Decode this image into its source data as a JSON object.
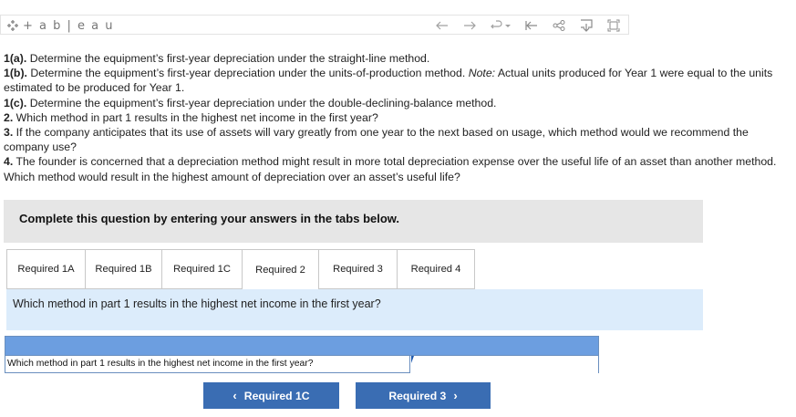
{
  "toolbar": {
    "logo_text": "+ a b | e a u",
    "icons": [
      "undo-arrow-icon",
      "redo-arrow-icon",
      "revert-icon",
      "dropdown-caret-icon",
      "reset-to-start-icon",
      "share-icon",
      "download-icon",
      "fullscreen-icon"
    ]
  },
  "question": {
    "lines": [
      {
        "num": "1(a).",
        "text": " Determine the equipment’s first-year depreciation under the straight-line method."
      },
      {
        "num": "1(b).",
        "text": " Determine the equipment’s first-year depreciation under the units-of-production method. ",
        "note_label": "Note:",
        "note_text": " Actual units produced for Year 1 were equal to the units estimated to be produced for Year 1."
      },
      {
        "num": "1(c).",
        "text": " Determine the equipment’s first-year depreciation under the double-declining-balance method."
      },
      {
        "num": "2.",
        "text": " Which method in part 1 results in the highest net income in the first year?"
      },
      {
        "num": "3.",
        "text": " If the company anticipates that its use of assets will vary greatly from one year to the next based on usage, which method would we recommend the company use?"
      },
      {
        "num": "4.",
        "text": " The founder is concerned that a depreciation method might result in more total depreciation expense over the useful life of an asset than another method. Which method would result in the highest amount of depreciation over an asset’s useful life?"
      }
    ]
  },
  "banner": {
    "text": "Complete this question by entering your answers in the tabs below."
  },
  "tabs": [
    {
      "label": "Required 1A",
      "active": false
    },
    {
      "label": "Required 1B",
      "active": false
    },
    {
      "label": "Required 1C",
      "active": false
    },
    {
      "label": "Required 2",
      "active": true
    },
    {
      "label": "Required 3",
      "active": false
    },
    {
      "label": "Required 4",
      "active": false
    }
  ],
  "panel": {
    "prompt": "Which method in part 1 results in the highest net income in the first year?"
  },
  "answer_table": {
    "row_label": "Which method in part 1 results in the highest net income in the first year?",
    "value": ""
  },
  "nav": {
    "prev_label": "Required 1C",
    "next_label": "Required 3"
  },
  "colors": {
    "accent_button": "#3a6db3",
    "table_header": "#6c9ee0",
    "panel_bg": "#dcecfb",
    "banner_bg": "#e6e6e6"
  }
}
